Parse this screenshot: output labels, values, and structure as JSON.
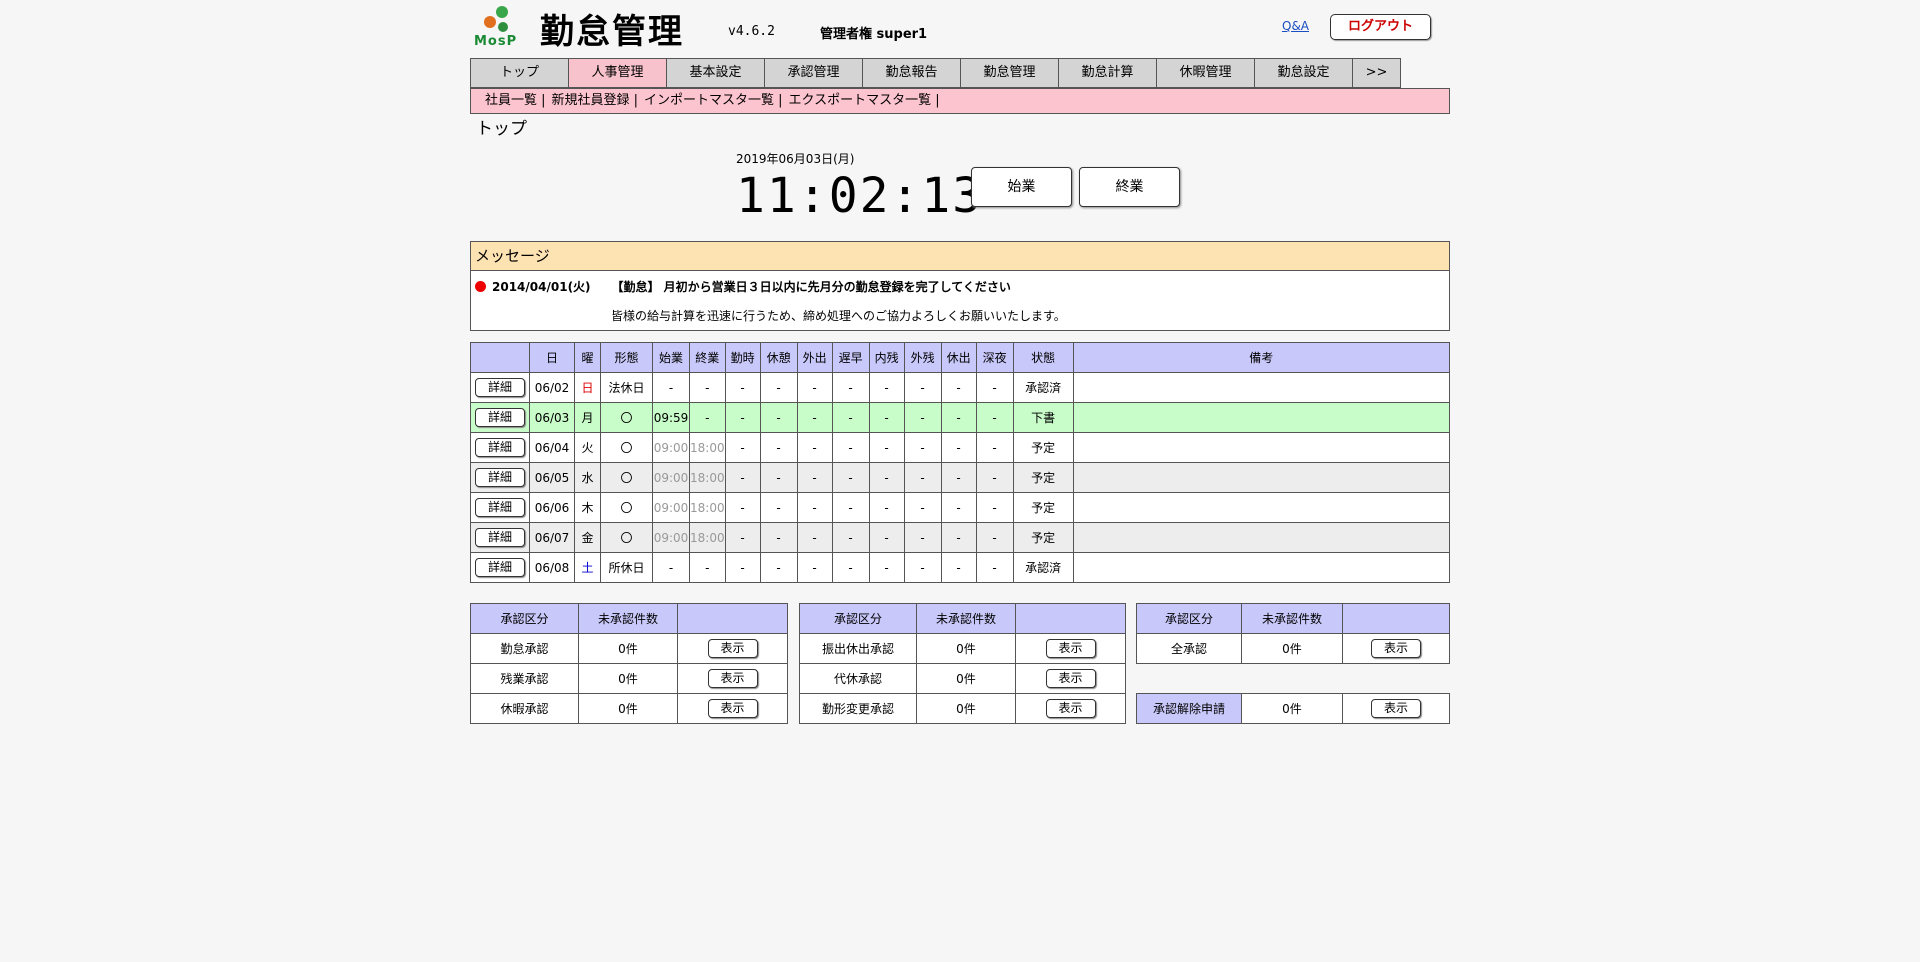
{
  "header": {
    "logo_text": "MosP",
    "app_title": "勤怠管理",
    "version": "v4.6.2",
    "role": "管理者権 super1",
    "qa_link": "Q&A",
    "logout": "ログアウト"
  },
  "nav": {
    "tabs": [
      "トップ",
      "人事管理",
      "基本設定",
      "承認管理",
      "勤怠報告",
      "勤怠管理",
      "勤怠計算",
      "休暇管理",
      "勤怠設定",
      ">>"
    ],
    "active_index": 1
  },
  "subnav": {
    "items": [
      "社員一覧 |",
      "新規社員登録 |",
      "インポートマスタ一覧 |",
      "エクスポートマスタ一覧 |"
    ]
  },
  "page_heading": "トップ",
  "clock": {
    "date": "2019年06月03日(月)",
    "time": "11:02:13",
    "start_label": "始業",
    "end_label": "終業"
  },
  "message": {
    "title": "メッセージ",
    "line1_date": "2014/04/01(火)",
    "line1_text": "【勤怠】 月初から営業日３日以内に先月分の勤怠登録を完了してください",
    "line2_text": "皆様の給与計算を迅速に行うため、締め処理へのご協力よろしくお願いいたします。"
  },
  "attendance": {
    "headers": [
      "",
      "日",
      "曜",
      "形態",
      "始業",
      "終業",
      "勤時",
      "休憩",
      "外出",
      "遅早",
      "内残",
      "外残",
      "休出",
      "深夜",
      "状態",
      "備考"
    ],
    "detail_label": "詳細",
    "rows": [
      {
        "date": "06/02",
        "dow": "日",
        "type": "法休日",
        "start": "-",
        "end": "-",
        "status": "承認済",
        "style": "white",
        "dowclass": "sun",
        "dim": false
      },
      {
        "date": "06/03",
        "dow": "月",
        "type": "〇",
        "start": "09:59",
        "end": "-",
        "status": "下書",
        "style": "green",
        "dowclass": "",
        "dim": false
      },
      {
        "date": "06/04",
        "dow": "火",
        "type": "〇",
        "start": "09:00",
        "end": "18:00",
        "status": "予定",
        "style": "white",
        "dowclass": "",
        "dim": true
      },
      {
        "date": "06/05",
        "dow": "水",
        "type": "〇",
        "start": "09:00",
        "end": "18:00",
        "status": "予定",
        "style": "gray",
        "dowclass": "",
        "dim": true
      },
      {
        "date": "06/06",
        "dow": "木",
        "type": "〇",
        "start": "09:00",
        "end": "18:00",
        "status": "予定",
        "style": "white",
        "dowclass": "",
        "dim": true
      },
      {
        "date": "06/07",
        "dow": "金",
        "type": "〇",
        "start": "09:00",
        "end": "18:00",
        "status": "予定",
        "style": "gray",
        "dowclass": "",
        "dim": true
      },
      {
        "date": "06/08",
        "dow": "土",
        "type": "所休日",
        "start": "-",
        "end": "-",
        "status": "承認済",
        "style": "white",
        "dowclass": "sat",
        "dim": false
      }
    ],
    "dash": "-"
  },
  "approvals": {
    "col_category": "承認区分",
    "col_count": "未承認件数",
    "show_label": "表示",
    "table1": [
      {
        "label": "勤怠承認",
        "count": "0件"
      },
      {
        "label": "残業承認",
        "count": "0件"
      },
      {
        "label": "休暇承認",
        "count": "0件"
      }
    ],
    "table2": [
      {
        "label": "振出休出承認",
        "count": "0件"
      },
      {
        "label": "代休承認",
        "count": "0件"
      },
      {
        "label": "勤形変更承認",
        "count": "0件"
      }
    ],
    "table3": [
      {
        "label": "全承認",
        "count": "0件"
      }
    ],
    "release": {
      "label": "承認解除申請",
      "count": "0件"
    }
  }
}
